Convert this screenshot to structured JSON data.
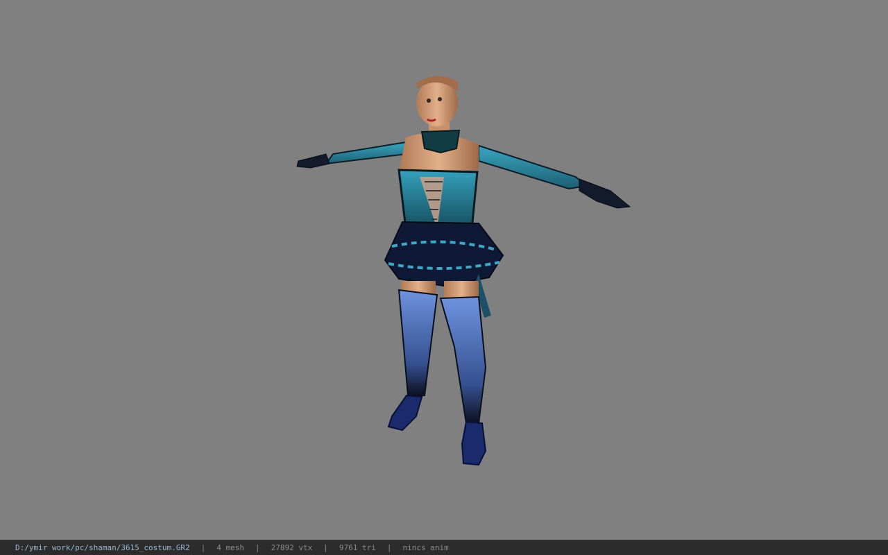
{
  "viewer": {
    "background_color": "#808080",
    "model_icon": "character-model-tpose"
  },
  "status_bar": {
    "file_path": "D:/ymir work/pc/shaman/3615_costum.GR2",
    "separator": "|",
    "mesh_count": "4 mesh",
    "vertex_count": "27892 vtx",
    "triangle_count": "9761 tri",
    "animation": "nincs anim"
  }
}
